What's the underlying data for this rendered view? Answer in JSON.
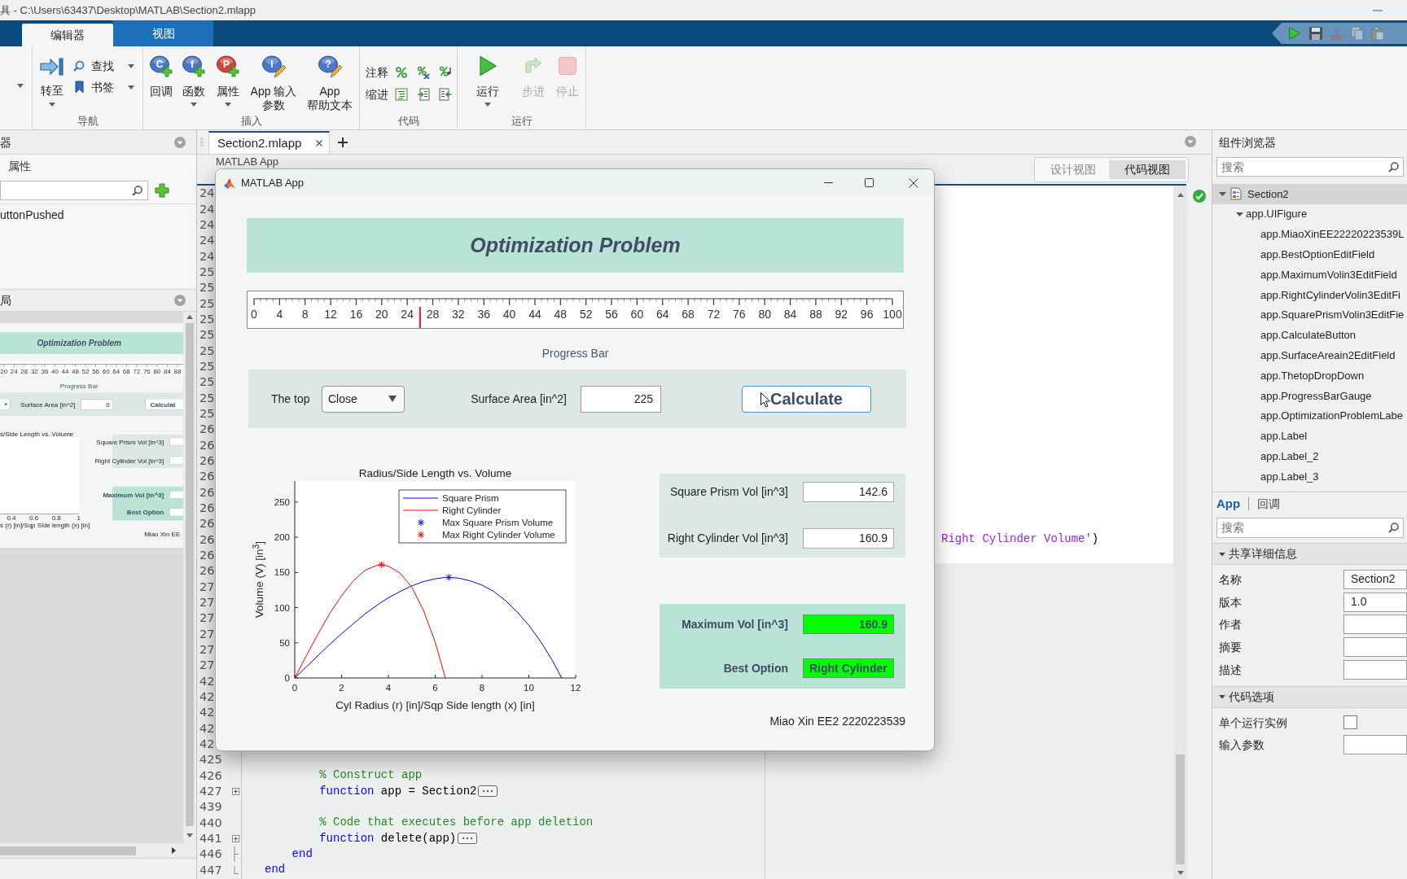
{
  "title_bar": {
    "title": "具 - C:\\Users\\63437\\Desktop\\MATLAB\\Section2.mlapp"
  },
  "ribbon_tabs": [
    {
      "label": "编辑器",
      "selected": true
    },
    {
      "label": "视图",
      "selected": false
    }
  ],
  "quick_access": [
    {
      "kind": "run",
      "disabled": false
    },
    {
      "kind": "save",
      "disabled": false
    },
    {
      "kind": "cut",
      "disabled": true
    },
    {
      "kind": "copy",
      "disabled": true
    },
    {
      "kind": "paste",
      "disabled": true
    }
  ],
  "clipped_group": {
    "has_menu": true
  },
  "ribbon_groups": [
    {
      "kind": "navigate",
      "label": "导航",
      "buttons": [
        {
          "kind": "goto",
          "label": "转至",
          "has_menu": true
        },
        {
          "kind": "find",
          "label": "查找",
          "has_menu": true
        },
        {
          "kind": "bookmark",
          "label": "书签",
          "has_menu": true
        }
      ]
    },
    {
      "kind": "insert",
      "label": "插入",
      "buttons": [
        {
          "kind": "callback",
          "glyph": "C",
          "lines": [
            "回调"
          ],
          "has_menu": false
        },
        {
          "kind": "function",
          "glyph": "f",
          "lines": [
            "函数"
          ],
          "has_menu": true
        },
        {
          "kind": "property",
          "glyph": "P",
          "lines": [
            "属性"
          ],
          "has_menu": true
        },
        {
          "kind": "input",
          "glyph": "I",
          "lines": [
            "App 输入",
            "参数"
          ],
          "has_menu": false
        },
        {
          "kind": "help",
          "glyph": "?",
          "lines": [
            "App",
            "帮助文本"
          ],
          "has_menu": false
        }
      ]
    },
    {
      "kind": "code",
      "label": "代码",
      "rows": [
        {
          "kind": "comment",
          "label": "注释"
        },
        {
          "kind": "indent",
          "label": "缩进"
        }
      ]
    },
    {
      "kind": "run",
      "label": "运行",
      "buttons": [
        {
          "kind": "run",
          "label": "运行",
          "has_menu": true,
          "disabled": false
        },
        {
          "kind": "step",
          "label": "步进",
          "has_menu": false,
          "disabled": true
        },
        {
          "kind": "stop",
          "label": "停止",
          "has_menu": false,
          "disabled": true
        }
      ]
    }
  ],
  "code_browser": {
    "heading": "器",
    "tabs": [
      {
        "label": "属性",
        "selected": false
      }
    ],
    "items": [
      {
        "label": "uttonPushed",
        "selected": false
      }
    ]
  },
  "app_layout": {
    "heading": "局",
    "preview": {
      "heading": "Optimization Problem",
      "gauge_ticks": [
        "20",
        "24",
        "28",
        "32",
        "36",
        "40",
        "44",
        "48",
        "52",
        "56",
        "60",
        "64",
        "68",
        "72",
        "76",
        "80",
        "84",
        "88"
      ],
      "gauge_label": "Progress Bar",
      "area_label": "Surface Area [in^2]",
      "area_value": "0",
      "button": "Calculat",
      "chart_title": "s/Side Length vs. Volume",
      "xticks": [
        "0.4",
        "0.6",
        "0.8",
        "1"
      ],
      "xlabel": "s (r) [in]/Sqp Side length (x) [in]",
      "volumes": [
        "Square Prism Vol [in^3]",
        "Right Cylinder Vol [in^3]"
      ],
      "results": [
        "Maximum Vol [in^3]",
        "Best Option"
      ],
      "footer": "Miao Xin EE"
    }
  },
  "editor": {
    "tab": "Section2.mlapp",
    "canvas_title": "MATLAB App",
    "views": [
      {
        "label": "设计视图",
        "selected": false
      },
      {
        "label": "代码视图",
        "selected": true
      }
    ],
    "blocks": [
      {
        "editable": true,
        "rows": [
          {
            "kind": "plain",
            "number": "24"
          },
          {
            "kind": "plain",
            "number": "24"
          },
          {
            "kind": "plain",
            "number": "24"
          },
          {
            "kind": "plain",
            "number": "24"
          },
          {
            "kind": "plain",
            "number": "24"
          },
          {
            "kind": "plain",
            "number": "25"
          },
          {
            "kind": "plain",
            "number": "25"
          },
          {
            "kind": "plain",
            "number": "25"
          },
          {
            "kind": "plain",
            "number": "25"
          },
          {
            "kind": "plain",
            "number": "25"
          },
          {
            "kind": "plain",
            "number": "25"
          },
          {
            "kind": "plain",
            "number": "25"
          },
          {
            "kind": "plain",
            "number": "25"
          },
          {
            "kind": "plain",
            "number": "25"
          },
          {
            "kind": "plain",
            "number": "25"
          },
          {
            "kind": "plain",
            "number": "26"
          },
          {
            "kind": "plain",
            "number": "26"
          },
          {
            "kind": "plain",
            "number": "26"
          },
          {
            "kind": "plain",
            "number": "26"
          },
          {
            "kind": "plain",
            "number": "26"
          },
          {
            "kind": "plain",
            "number": "26"
          },
          {
            "kind": "plain",
            "number": "26"
          },
          {
            "kind": "plain",
            "number": "26",
            "tail": [
              {
                "kind": "string",
                "text": "Right Cylinder Volume'"
              },
              {
                "kind": "plain",
                "text": ")"
              }
            ]
          },
          {
            "kind": "plain",
            "number": "26"
          }
        ]
      },
      {
        "editable": false,
        "rows": [
          {
            "kind": "plain",
            "number": "26"
          },
          {
            "kind": "plain",
            "number": "27"
          },
          {
            "kind": "plain",
            "number": "27"
          },
          {
            "kind": "plain",
            "number": "27"
          },
          {
            "kind": "plain",
            "number": "27"
          },
          {
            "kind": "plain",
            "number": "27"
          },
          {
            "kind": "plain",
            "number": "27"
          },
          {
            "kind": "plain",
            "number": "42"
          },
          {
            "kind": "plain",
            "number": "42"
          },
          {
            "kind": "plain",
            "number": "42"
          },
          {
            "kind": "plain",
            "number": "42"
          },
          {
            "kind": "plain",
            "number": "42"
          },
          {
            "kind": "plain",
            "number": "425"
          },
          {
            "kind": "plain",
            "number": "426",
            "tokens": [
              {
                "kind": "comment",
                "text": "        % Construct app"
              }
            ]
          },
          {
            "kind": "folded",
            "number": "427",
            "tokens": [
              {
                "kind": "keyword",
                "text": "        function"
              },
              {
                "kind": "plain",
                "text": " app = Section2"
              }
            ]
          },
          {
            "kind": "plain",
            "number": "439"
          },
          {
            "kind": "plain",
            "number": "440",
            "tokens": [
              {
                "kind": "comment",
                "text": "        % Code that executes before app deletion"
              }
            ]
          },
          {
            "kind": "folded",
            "number": "441",
            "tokens": [
              {
                "kind": "keyword",
                "text": "        function"
              },
              {
                "kind": "plain",
                "text": " delete(app)"
              }
            ]
          },
          {
            "kind": "block_end",
            "number": "446",
            "tokens": [
              {
                "kind": "keyword",
                "text": "    end"
              }
            ]
          },
          {
            "kind": "last_end",
            "number": "447",
            "tokens": [
              {
                "kind": "keyword",
                "text": "end"
              }
            ]
          }
        ]
      }
    ]
  },
  "component_browser": {
    "heading": "组件浏览器",
    "search": {
      "placeholder": "搜索"
    },
    "tree": [
      {
        "label": "Section2",
        "selected": true,
        "expanded": true,
        "children": [
          {
            "label": "app.UIFigure",
            "selected": false,
            "expanded": true,
            "children": [
              {
                "label": "app.MiaoXinEE22220223539L",
                "selected": false
              },
              {
                "label": "app.BestOptionEditField",
                "selected": false
              },
              {
                "label": "app.MaximumVolin3EditField",
                "selected": false
              },
              {
                "label": "app.RightCylinderVolin3EditFi",
                "selected": false
              },
              {
                "label": "app.SquarePrismVolin3EditFie",
                "selected": false
              },
              {
                "label": "app.CalculateButton",
                "selected": false
              },
              {
                "label": "app.SurfaceAreain2EditField",
                "selected": false
              },
              {
                "label": "app.ThetopDropDown",
                "selected": false
              },
              {
                "label": "app.ProgressBarGauge",
                "selected": false
              },
              {
                "label": "app.OptimizationProblemLabe",
                "selected": false
              },
              {
                "label": "app.Label",
                "selected": false
              },
              {
                "label": "app.Label_2",
                "selected": false
              },
              {
                "label": "app.Label_3",
                "selected": false
              }
            ]
          }
        ]
      }
    ]
  },
  "inspector": {
    "tabs": [
      {
        "label": "App",
        "selected": true
      },
      {
        "label": "回调",
        "selected": false
      }
    ],
    "search": {
      "placeholder": "搜索"
    },
    "sections": [
      {
        "label": "共享详细信息",
        "expanded": true,
        "fields": [
          {
            "kind": "text",
            "label": "名称",
            "value": "Section2"
          },
          {
            "kind": "text",
            "label": "版本",
            "value": "1.0"
          },
          {
            "kind": "text",
            "label": "作者"
          },
          {
            "kind": "text",
            "label": "摘要"
          },
          {
            "kind": "text",
            "label": "描述"
          }
        ]
      },
      {
        "label": "代码选项",
        "expanded": true,
        "fields": [
          {
            "kind": "checkbox",
            "label": "单个运行实例",
            "checked": false
          },
          {
            "kind": "text",
            "label": "输入参数"
          }
        ]
      }
    ]
  },
  "dialog": {
    "title": "MATLAB App",
    "heading": "Optimization Problem",
    "gauge": {
      "level": 0.26,
      "ticks": [
        "0",
        "4",
        "8",
        "12",
        "16",
        "20",
        "24",
        "28",
        "32",
        "36",
        "40",
        "44",
        "48",
        "52",
        "56",
        "60",
        "64",
        "68",
        "72",
        "76",
        "80",
        "84",
        "88",
        "92",
        "96",
        "100"
      ]
    },
    "gauge_label": "Progress Bar",
    "controls": {
      "top_label": "The top",
      "top_value": "Close",
      "area_label": "Surface Area [in^2]",
      "area_value": "225",
      "button": "Calculate"
    },
    "chart_data": {
      "type": "line",
      "title": "Radius/Side Length vs. Volume",
      "xlabel": "Cyl Radius (r) [in]/Sqp Side length (x) [in]",
      "ylabel": "Volume (V) [in$^{3}$]",
      "x": [
        0,
        0.5,
        1,
        1.5,
        2,
        2.5,
        3,
        3.5,
        3.71,
        4,
        4.5,
        5,
        5.5,
        6,
        6.43,
        6.5,
        6.58,
        7,
        7.5,
        8,
        8.5,
        9,
        9.5,
        10,
        10.5,
        11,
        11.4
      ],
      "series": [
        {
          "name": "Square Prism",
          "color": "#0000ff",
          "values": [
            0,
            16,
            32,
            48,
            63,
            77,
            91,
            103,
            108,
            114,
            123,
            131,
            137,
            141,
            143,
            143,
            143,
            142,
            138,
            132,
            123,
            110,
            94,
            75,
            52,
            25,
            0
          ]
        },
        {
          "name": "Right Cylinder",
          "color": "#ff0000",
          "values": [
            0,
            32,
            63,
            92,
            117,
            138,
            153,
            160,
            161,
            159,
            149,
            129,
            96,
            51,
            0,
            null,
            null,
            null,
            null,
            null,
            null,
            null,
            null,
            null,
            null,
            null,
            null
          ]
        },
        {
          "name": "Max Square Prism Volume",
          "color": "#0000ff",
          "marker": "cross",
          "values": [
            null,
            null,
            null,
            null,
            null,
            null,
            null,
            null,
            null,
            null,
            null,
            null,
            null,
            null,
            null,
            null,
            143,
            null,
            null,
            null,
            null,
            null,
            null,
            null,
            null,
            null,
            null
          ]
        },
        {
          "name": "Max Right Cylinder Volume",
          "color": "#ff0000",
          "marker": "cross",
          "values": [
            null,
            null,
            null,
            null,
            null,
            null,
            null,
            null,
            161,
            null,
            null,
            null,
            null,
            null,
            null,
            null,
            null,
            null,
            null,
            null,
            null,
            null,
            null,
            null,
            null,
            null,
            null
          ]
        }
      ],
      "xlim": [
        0,
        12
      ],
      "ylim": [
        0,
        280
      ],
      "xticks": [
        {
          "value": 0,
          "label": "0"
        },
        {
          "value": 2,
          "label": "2"
        },
        {
          "value": 4,
          "label": "4"
        },
        {
          "value": 6,
          "label": "6"
        },
        {
          "value": 8,
          "label": "8"
        },
        {
          "value": 10,
          "label": "10"
        },
        {
          "value": 12,
          "label": "12"
        }
      ],
      "yticks": [
        {
          "value": 0,
          "label": "0"
        },
        {
          "value": 50,
          "label": "50"
        },
        {
          "value": 100,
          "label": "100"
        },
        {
          "value": 150,
          "label": "150"
        },
        {
          "value": 200,
          "label": "200"
        },
        {
          "value": 250,
          "label": "250"
        }
      ],
      "legend": "upper right"
    },
    "volumes": [
      {
        "kind": "number",
        "label": "Square Prism Vol [in^3]",
        "value": "142.6",
        "highlighted": false
      },
      {
        "kind": "number",
        "label": "Right Cylinder Vol [in^3]",
        "value": "160.9",
        "highlighted": false
      }
    ],
    "results": [
      {
        "kind": "number",
        "label": "Maximum Vol [in^3]",
        "value": "160.9",
        "highlighted": true
      },
      {
        "kind": "text",
        "label": "Best Option",
        "value": "Right Cylinder",
        "highlighted": true
      }
    ],
    "footer": "Miao Xin EE2 2220223539"
  }
}
